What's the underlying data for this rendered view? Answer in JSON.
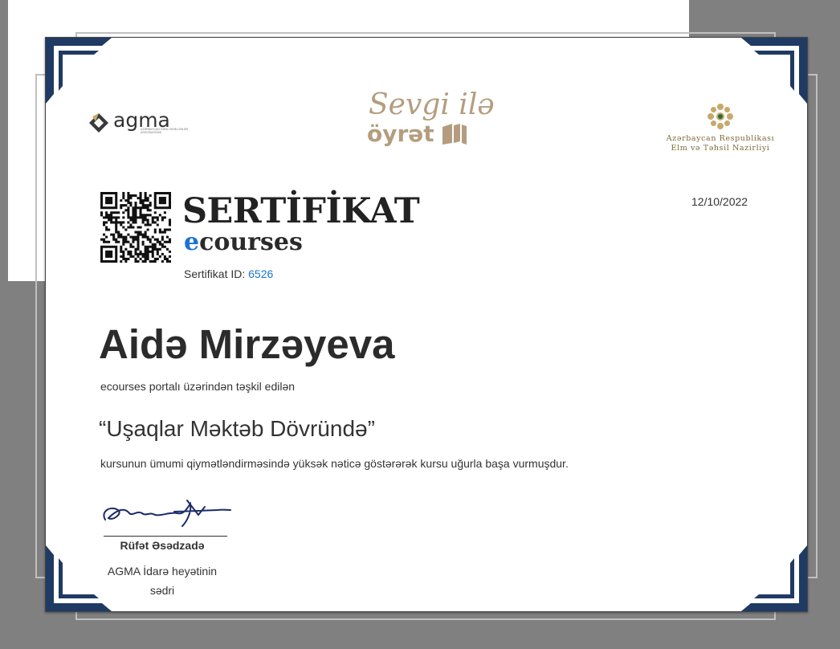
{
  "logos": {
    "agma": {
      "name": "agma",
      "subtitle": "AZƏRBAYCAN GƏNC MÜƏLLİMLƏR ASSOSİASİYASI"
    },
    "campaign": {
      "line1": "Sevgi ilə",
      "line2": "öyrət"
    },
    "ministry": {
      "line1": "Azərbaycan Respublikası",
      "line2": "Elm və Təhsil Nazirliyi"
    }
  },
  "certificate": {
    "title": "SERTİFİKAT",
    "platform_e": "e",
    "platform_rest": "courses",
    "id_label": "Sertifikat ID: ",
    "id_value": "6526",
    "date": "12/10/2022",
    "recipient": "Aidə Mirzəyeva",
    "intro": "ecourses portalı üzərindən təşkil edilən",
    "course": "“Uşaqlar Məktəb Dövründə”",
    "completion": "kursunun ümumi qiymətləndirməsində yüksək nəticə göstərərək kursu uğurla başa vurmuşdur.",
    "signer_name": "Rüfət Əsədzadə",
    "signer_role": "AGMA İdarə heyətinin sədri"
  },
  "colors": {
    "frame_navy": "#1f3a63",
    "gold": "#b49d7e",
    "link_blue": "#1a73d9"
  },
  "icons": [
    "agma-logo-icon",
    "book-icon",
    "emblem-icon",
    "qr-code-icon",
    "signature"
  ]
}
